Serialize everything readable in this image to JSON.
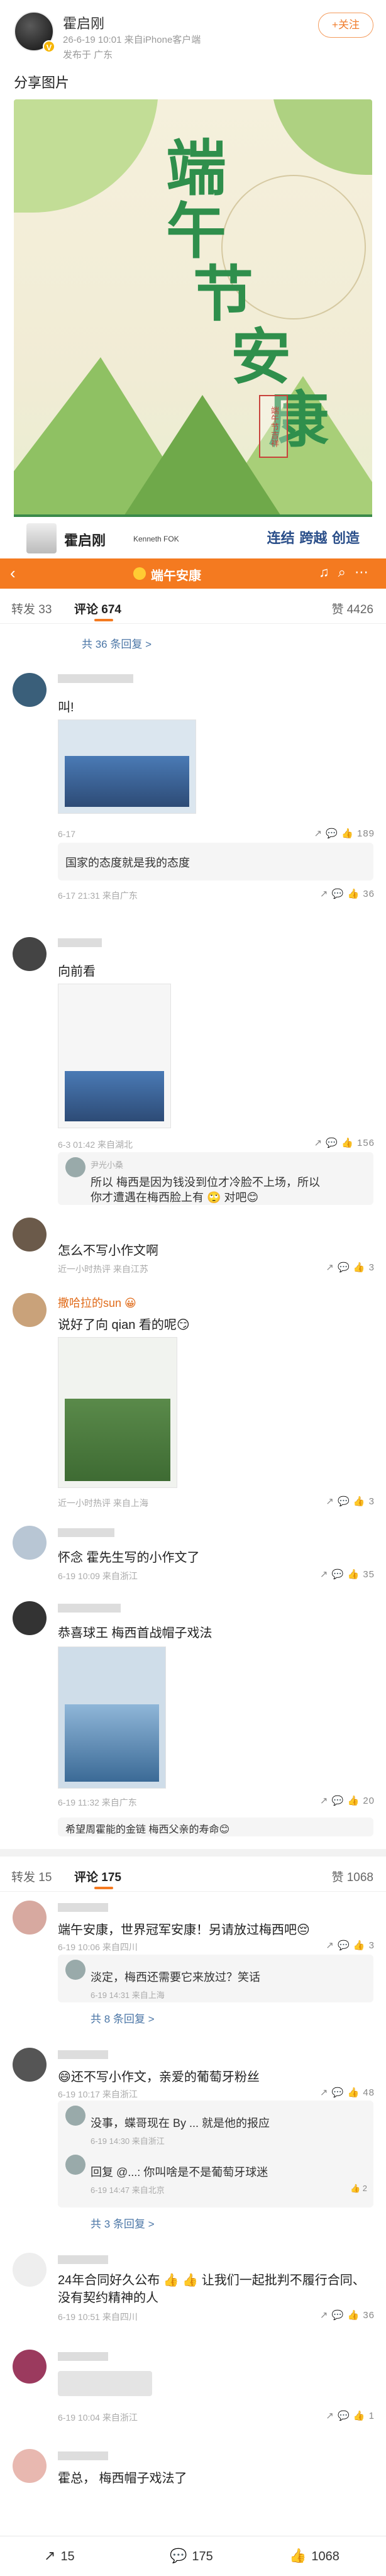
{
  "post": {
    "author": "霍启刚",
    "meta": "26-6-19 10:01  来自iPhone客户端",
    "location": "发布于 广东",
    "follow_label": "+关注",
    "text": "分享图片"
  },
  "poster": {
    "title_chars": [
      "端",
      "午",
      "节",
      "安",
      "康"
    ],
    "seal_text": "端午节吉祥",
    "footer_name": "霍启刚",
    "footer_en": "Kenneth FOK",
    "footer_slogan": "连结 跨越 创造"
  },
  "topic_bar": {
    "back_icon": "chevron-left-icon",
    "title": "端午安康",
    "icons": [
      "headphones-icon",
      "search-icon",
      "more-icon"
    ]
  },
  "tabs1": {
    "repost": "转发 33",
    "comment": "评论 674",
    "like": "赞 4426"
  },
  "comments1": {
    "expand_label": "共 36 条回复 >",
    "c1": {
      "name": "",
      "text": "叫!",
      "meta": "6-17",
      "actions": "↗  💬  👍 189"
    },
    "c2": {
      "name": "",
      "text": "国家的态度就是我的态度",
      "meta": "6-17 21:31 来自广东",
      "actions": "↗  💬  👍 36"
    },
    "c3": {
      "name": "",
      "text": "向前看",
      "meta": "6-3 01:42 来自湖北",
      "actions": "↗  💬  👍 156"
    },
    "c3_reply": {
      "name": "尹光小桑",
      "text": "所以 梅西是因为钱没到位才冷脸不上场，所以",
      "text2": "你才遭遇在梅西脸上有 🙄 对吧😊"
    },
    "c4": {
      "text": "怎么不写小作文啊",
      "meta": "近一小时热评 来自江苏",
      "actions": "↗  💬  👍 3"
    },
    "c5": {
      "name": "撒哈拉的sun 😀",
      "text": "说好了向 qian 看的呢😏",
      "meta": "近一小时热评 来自上海",
      "actions": "↗  💬  👍 3"
    },
    "c6": {
      "text": "怀念 霍先生写的小作文了",
      "meta": "6-19 10:09 来自浙江",
      "actions": "↗  💬  👍 35"
    },
    "c7": {
      "text": "恭喜球王 梅西首战帽子戏法",
      "meta": "6-19 11:32 来自广东",
      "actions": "↗  💬  👍 20"
    },
    "c7_reply": "希望周霍能的金链  梅西父亲的寿命😊"
  },
  "tabs2": {
    "repost": "转发 15",
    "comment": "评论 175",
    "like": "赞 1068"
  },
  "comments2": {
    "d1": {
      "text": "端午安康，世界冠军安康！另请放过梅西吧😔",
      "meta": "6-19 10:06 来自四川",
      "actions": "↗  💬  👍 3"
    },
    "d1_reply": {
      "text": "淡定，梅西还需要它来放过？笑话",
      "meta": "6-19 14:31 来自上海"
    },
    "d1_more": "共 8 条回复 >",
    "d2": {
      "text": "😄还不写小作文，亲爱的葡萄牙粉丝",
      "meta": "6-19 10:17 来自浙江",
      "actions": "↗  💬  👍 48"
    },
    "d2_reply1": {
      "text": "没事，蝶哥现在 By ... 就是他的报应",
      "meta": "6-19 14:30 来自浙江"
    },
    "d2_reply2": {
      "text": "回复 @...: 你叫啥是不是葡萄牙球迷",
      "meta": "6-19 14:47 来自北京",
      "actions": "👍 2"
    },
    "d2_more": "共 3 条回复 >",
    "d3": {
      "text": "24年合同好久公布 👍 👍 让我们一起批判不履行合同、没有契约精神的人",
      "meta": "6-19 10:51 来自四川",
      "actions": "↗  💬  👍 36"
    },
    "d4": {
      "text": "",
      "meta": "6-19 10:04 来自浙江",
      "actions": "↗  💬  👍 1"
    },
    "d5": {
      "text": "霍总， 梅西帽子戏法了"
    }
  },
  "bottom_bar": {
    "repost": "15",
    "comment": "175",
    "like": "1068"
  }
}
